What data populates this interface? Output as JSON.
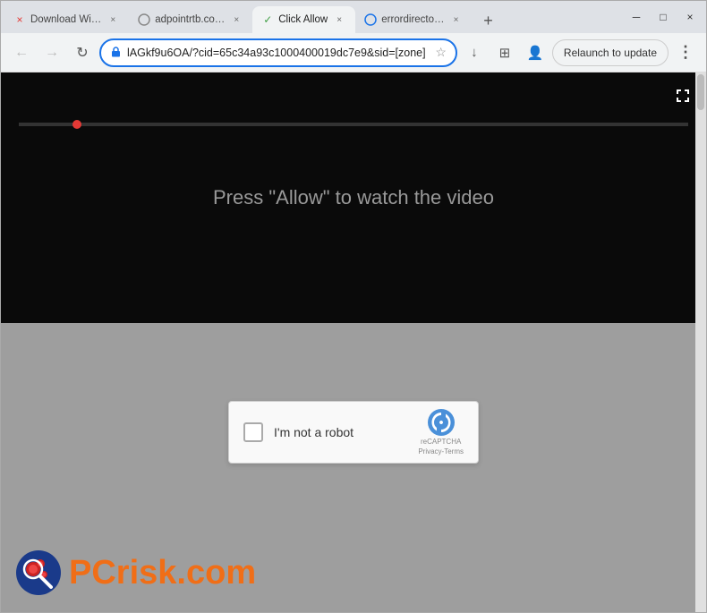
{
  "browser": {
    "tabs": [
      {
        "id": "tab-1",
        "title": "Download Wi…",
        "favicon": "×",
        "favicon_color": "red",
        "active": false,
        "close_label": "×"
      },
      {
        "id": "tab-2",
        "title": "adpointrtb.co…",
        "favicon": "○",
        "favicon_color": "gray",
        "active": false,
        "close_label": "×"
      },
      {
        "id": "tab-3",
        "title": "Click Allow",
        "favicon": "✓",
        "favicon_color": "green",
        "active": true,
        "close_label": "×"
      },
      {
        "id": "tab-4",
        "title": "errordirecto…",
        "favicon": "○",
        "favicon_color": "blue",
        "active": false,
        "close_label": "×"
      }
    ],
    "new_tab_label": "+",
    "window_controls": {
      "minimize": "─",
      "maximize": "□",
      "close": "×"
    }
  },
  "toolbar": {
    "back_label": "←",
    "forward_label": "→",
    "reload_label": "↻",
    "address": "lAGkf9u6OA/?cid=65c34a93c1000400019dc7e9&sid=[zone]",
    "star_label": "☆",
    "download_label": "↓",
    "extensions_label": "⊞",
    "profile_label": "👤",
    "relaunch_label": "Relaunch to update",
    "menu_label": "⋮"
  },
  "page": {
    "video": {
      "text": "Press \"Allow\" to watch the video"
    },
    "captcha": {
      "checkbox_label": "",
      "text": "I'm not a robot",
      "brand": "reCAPTCHA",
      "privacy": "Privacy",
      "dash": "-",
      "terms": "Terms"
    },
    "watermark": {
      "prefix": "PC",
      "suffix": "risk.com"
    }
  }
}
